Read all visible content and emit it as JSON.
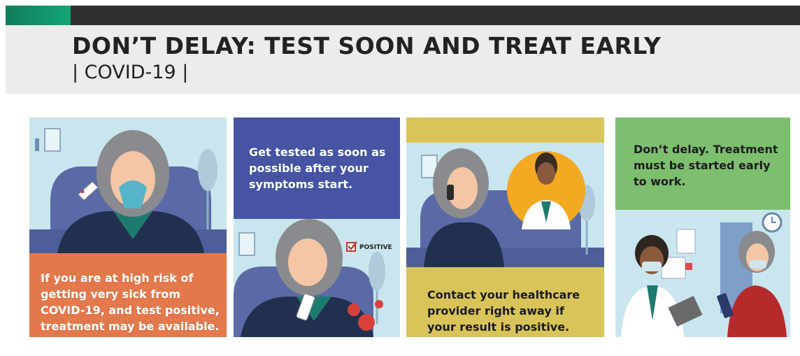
{
  "header": {
    "title": "DON’T DELAY: TEST SOON AND TREAT EARLY",
    "subtitle": "| COVID-19 |"
  },
  "panels": [
    {
      "text": "If you are at high risk of getting very sick from COVID-19, and test positive, treatment may be available."
    },
    {
      "text": "Get tested as soon as possible after your symptoms start.",
      "badge": "POSITIVE"
    },
    {
      "text": "Contact your healthcare provider right away if your result is positive."
    },
    {
      "text": "Don’t delay. Treatment must be started early to work."
    }
  ],
  "colors": {
    "accent": "#16a577",
    "bar": "#2f2f30",
    "orange": "#e2784b",
    "blue": "#4654a3",
    "mustard": "#d9c45a",
    "green": "#7dbf6f",
    "room": "#c9e6ef"
  }
}
